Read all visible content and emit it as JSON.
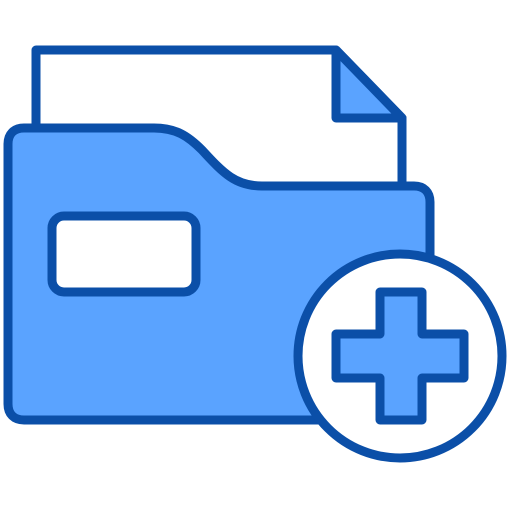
{
  "icon": {
    "name": "add-folder-icon",
    "parts": {
      "document": "document-icon",
      "folder": "folder-icon",
      "label": "folder-label",
      "badge": "add-badge-icon",
      "plus": "plus-icon"
    }
  },
  "colors": {
    "stroke": "#0b4fa8",
    "fill": "#5aa3ff",
    "background": "#ffffff"
  }
}
